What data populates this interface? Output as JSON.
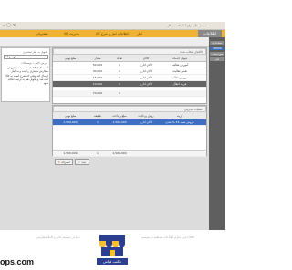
{
  "titlebar": {
    "text": "سیستم مالی برای انبار کسب و کار"
  },
  "ribbon": {
    "active_tab": "اطلاعات",
    "items": [
      "انبار",
      "اطلاعات انبار و شرح کالا",
      "مدیریت کالا",
      "مشتریان"
    ]
  },
  "sidebar": {
    "items": [
      {
        "label": "حسابداری"
      },
      {
        "label": "ORDER"
      },
      {
        "label": "صورتحساب"
      },
      {
        "label": "انبار"
      }
    ]
  },
  "order_panel": {
    "customer_label": "تحویل به انبار/مشتری",
    "customer_value": "تهیه و کد",
    "notes_label": "آدرس کامل / توضیحات",
    "description": "هست سیستم فروش CPU است که سفارش مشتری را ثبت و به انبار ارسال کند وقتی که شرح است به کالا ثبت شد و تحویل هم به ترتیب انجام شود"
  },
  "products": {
    "header": {
      "title": "کالاهای انتخاب شده"
    },
    "columns": [
      "عنوان خدمات",
      "کالای",
      "تعداد",
      "مقدار",
      "مبلغ نهایی"
    ],
    "rows": [
      {
        "name": "آموزش فعالیت",
        "type": "کالای اداری",
        "qty": "1",
        "amount": "50,000",
        "total": "1"
      },
      {
        "name": "تعمیر فعالیت",
        "type": "کالای اداری",
        "qty": "1",
        "amount": "30,000",
        "total": "1"
      },
      {
        "name": "سرویس فعالیت",
        "type": "کالای اداری",
        "qty": "1",
        "amount": "15,000",
        "total": "1"
      },
      {
        "name": "هزینه انتقال",
        "type": "کالای اداری",
        "qty": "1",
        "amount": "10,000",
        "total": "1"
      },
      {
        "name": "",
        "type": "",
        "qty": "",
        "amount": "70,000",
        "total": "1"
      }
    ]
  },
  "payments": {
    "header": {
      "title": "عملیات مدیریتی"
    },
    "columns": [
      "گزینه",
      "روش پرداخت",
      "مبلغ پرداخت",
      "تخفیف",
      "مبلغ نهایی"
    ],
    "rows": [
      {
        "item": "فروش نسیه 33 % نقدی",
        "method": "کالای اداری",
        "paid": "1,500,000",
        "discount": "1",
        "final": "1,500,000"
      }
    ],
    "footer": {
      "paid": "1,500,000",
      "discount": "1",
      "final": "1,500,000"
    }
  },
  "actions": {
    "cancel_label": "انصراف",
    "save_label": "ثبت"
  },
  "bottom": {
    "caption_left": "طراحی سیستم جامع و کاملا سفارشی",
    "caption_right": "ذخیره سازی اطلاعات مستقیم در سیستم ERP",
    "logo_text": "مکتب قیاس",
    "url_text": "ops.com"
  }
}
